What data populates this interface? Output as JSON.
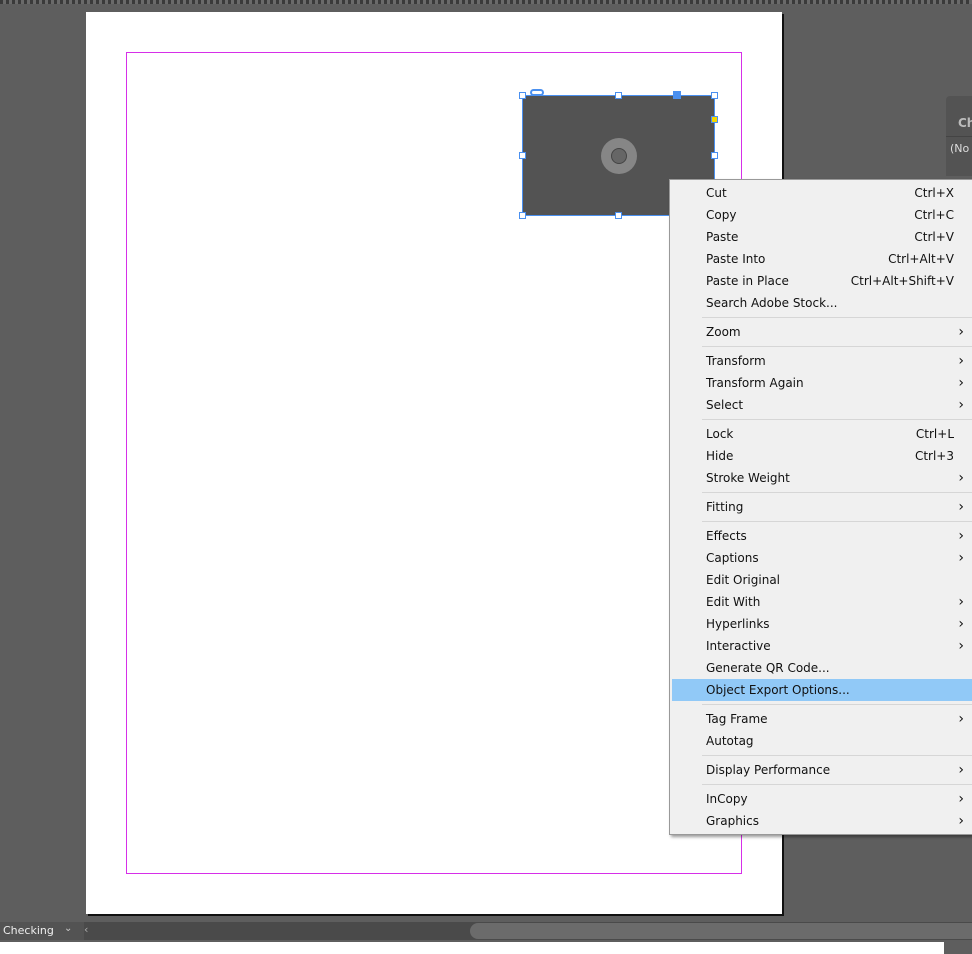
{
  "panel": {
    "title": "Ch",
    "value": "(No"
  },
  "menu": {
    "groups": [
      [
        {
          "label": "Cut",
          "shortcut": "Ctrl+X"
        },
        {
          "label": "Copy",
          "shortcut": "Ctrl+C"
        },
        {
          "label": "Paste",
          "shortcut": "Ctrl+V"
        },
        {
          "label": "Paste Into",
          "shortcut": "Ctrl+Alt+V"
        },
        {
          "label": "Paste in Place",
          "shortcut": "Ctrl+Alt+Shift+V"
        },
        {
          "label": "Search Adobe Stock...",
          "shortcut": ""
        }
      ],
      [
        {
          "label": "Zoom",
          "submenu": true
        }
      ],
      [
        {
          "label": "Transform",
          "submenu": true
        },
        {
          "label": "Transform Again",
          "submenu": true
        },
        {
          "label": "Select",
          "submenu": true
        }
      ],
      [
        {
          "label": "Lock",
          "shortcut": "Ctrl+L"
        },
        {
          "label": "Hide",
          "shortcut": "Ctrl+3"
        },
        {
          "label": "Stroke Weight",
          "submenu": true
        }
      ],
      [
        {
          "label": "Fitting",
          "submenu": true
        }
      ],
      [
        {
          "label": "Effects",
          "submenu": true
        },
        {
          "label": "Captions",
          "submenu": true
        },
        {
          "label": "Edit Original"
        },
        {
          "label": "Edit With",
          "submenu": true
        },
        {
          "label": "Hyperlinks",
          "submenu": true
        },
        {
          "label": "Interactive",
          "submenu": true
        },
        {
          "label": "Generate QR Code..."
        },
        {
          "label": "Object Export Options...",
          "highlighted": true
        }
      ],
      [
        {
          "label": "Tag Frame",
          "submenu": true
        },
        {
          "label": "Autotag"
        }
      ],
      [
        {
          "label": "Display Performance",
          "submenu": true
        }
      ],
      [
        {
          "label": "InCopy",
          "submenu": true
        },
        {
          "label": "Graphics",
          "submenu": true
        }
      ]
    ]
  },
  "status": {
    "preflight": "Checking",
    "dropdown_icon": "chevron-down-icon",
    "scroll_left_icon": "chevron-left-icon"
  },
  "colors": {
    "highlight": "#91c9f7",
    "margin": "#d62fe8",
    "selection": "#4a90f0"
  }
}
